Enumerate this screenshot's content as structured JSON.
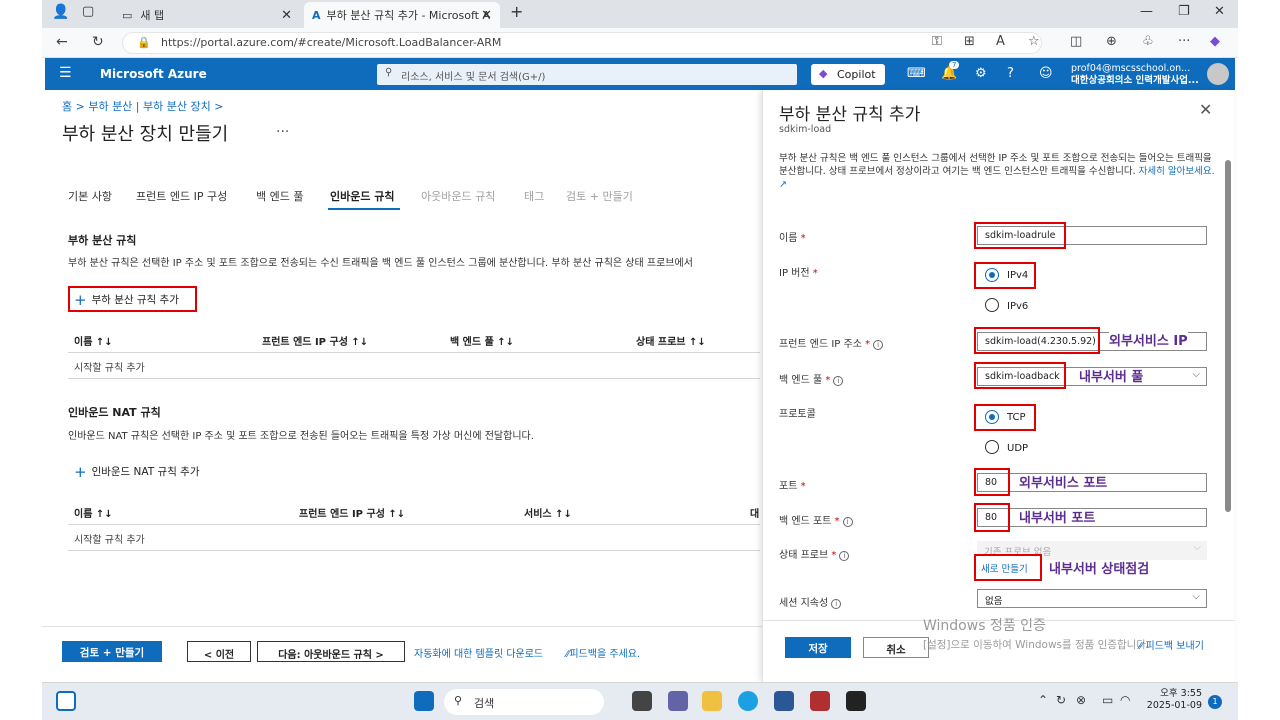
{
  "browser": {
    "tab_inactive": "새 탭",
    "tab_active": "부하 분산 규칙 추가 - Microsoft A",
    "url": "https://portal.azure.com/#create/Microsoft.LoadBalancer-ARM"
  },
  "azure": {
    "brand": "Microsoft Azure",
    "search_placeholder": "리소스, 서비스 및 문서 검색(G+/)",
    "copilot": "Copilot",
    "notif_count": "7",
    "user_email": "prof04@mscsschool.on...",
    "user_org": "대한상공회의소 인력개발사업..."
  },
  "page": {
    "breadcrumb": "홈 > 부하 분산 | 부하 분산 장치 >",
    "title": "부하 분산 장치 만들기",
    "more": "···",
    "tabs": [
      "기본 사항",
      "프런트 엔드 IP 구성",
      "백 엔드 풀",
      "인바운드 규칙",
      "아웃바운드 규칙",
      "태그",
      "검토 + 만들기"
    ],
    "lb_rules": {
      "heading": "부하 분산 규칙",
      "desc": "부하 분산 규칙은 선택한 IP 주소 및 포트 조합으로 전송되는 수신 트래픽을 백 엔드 풀 인스턴스 그룹에 분산합니다. 부하 분산 규칙은 상태 프로브에서",
      "add": "부하 분산 규칙 추가",
      "cols": [
        "이름 ↑↓",
        "프런트 엔드 IP 구성 ↑↓",
        "백 엔드 풀 ↑↓",
        "상태 프로브 ↑↓"
      ],
      "empty": "시작할 규칙 추가"
    },
    "nat_rules": {
      "heading": "인바운드 NAT 규칙",
      "desc": "인바운드 NAT 규칙은 선택한 IP 주소 및 포트 조합으로 전송된 들어오는 트래픽을 특정 가상 머신에 전달합니다.",
      "add": "인바운드 NAT 규칙 추가",
      "cols": [
        "이름 ↑↓",
        "프런트 엔드 IP 구성 ↑↓",
        "서비스 ↑↓",
        "대"
      ],
      "empty": "시작할 규칙 추가"
    },
    "footer": {
      "review": "검토 + 만들기",
      "prev": "< 이전",
      "next": "다음: 아웃바운드 규칙 >",
      "template": "자동화에 대한 템플릿 다운로드",
      "feedback": "⁄⁄피드백을 주세요."
    }
  },
  "panel": {
    "title": "부하 분산 규칙 추가",
    "subtitle": "sdkim-load",
    "desc": "부하 분산 규칙은 백 엔드 풀 인스턴스 그룹에서 선택한 IP 주소 및 포트 조합으로 전송되는 들어오는 트래픽을 분산합니다. 상태 프로브에서 정상이라고 여기는 백 엔드 인스턴스만 트래픽을 수신합니다.",
    "learn_more": "자세히 알아보세요.",
    "fields": {
      "name_label": "이름",
      "name_value": "sdkim-loadrule",
      "ipver_label": "IP 버전",
      "ipv4": "IPv4",
      "ipv6": "IPv6",
      "fe_label": "프런트 엔드 IP 주소",
      "fe_value": "sdkim-load(4.230.5.92)",
      "be_label": "백 엔드 풀",
      "be_value": "sdkim-loadback",
      "proto_label": "프로토콜",
      "tcp": "TCP",
      "udp": "UDP",
      "port_label": "포트",
      "port_value": "80",
      "beport_label": "백 엔드 포트",
      "beport_value": "80",
      "probe_label": "상태 프로브",
      "probe_value": "기존 프로브 없음",
      "probe_new": "새로 만들기",
      "session_label": "세션 지속성",
      "session_value": "없음"
    },
    "ipv4_selected": true,
    "tcp_selected": true,
    "annotations": {
      "fe": "외부서비스 IP",
      "be": "내부서버 풀",
      "port": "외부서비스 포트",
      "beport": "내부서버 포트",
      "probe": "내부서버 상태점검"
    },
    "save": "저장",
    "cancel": "취소",
    "watermark1": "Windows 정품 인증",
    "watermark2": "[설정]으로 이동하여 Windows를 정품 인증합니다.",
    "feedback": "피드백 보내기"
  },
  "taskbar": {
    "search": "검색",
    "time": "오후 3:55",
    "date": "2025-01-09",
    "notif": "1"
  },
  "colors": {
    "accent": "#0f6cbd",
    "highlight": "#e00000",
    "annotation": "#5c2d91"
  }
}
